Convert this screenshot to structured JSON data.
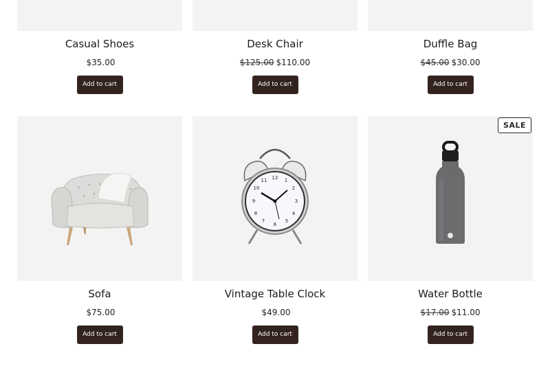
{
  "products": [
    {
      "title": "Casual Shoes",
      "price": "$35.00",
      "old_price": "",
      "button": "Add to cart",
      "badge": "",
      "image": "shoes"
    },
    {
      "title": "Desk Chair",
      "price": "$110.00",
      "old_price": "$125.00",
      "button": "Add to cart",
      "badge": "",
      "image": "chair"
    },
    {
      "title": "Duffle Bag",
      "price": "$30.00",
      "old_price": "$45.00",
      "button": "Add to cart",
      "badge": "",
      "image": "bag"
    },
    {
      "title": "Sofa",
      "price": "$75.00",
      "old_price": "",
      "button": "Add to cart",
      "badge": "",
      "image": "sofa-chair"
    },
    {
      "title": "Vintage Table Clock",
      "price": "$49.00",
      "old_price": "",
      "button": "Add to cart",
      "badge": "",
      "image": "alarm-clock"
    },
    {
      "title": "Water Bottle",
      "price": "$11.00",
      "old_price": "$17.00",
      "button": "Add to cart",
      "badge": "SALE",
      "image": "water-bottle"
    }
  ],
  "colors": {
    "button_bg": "#33231f",
    "thumb_bg": "#f3f3f3"
  }
}
